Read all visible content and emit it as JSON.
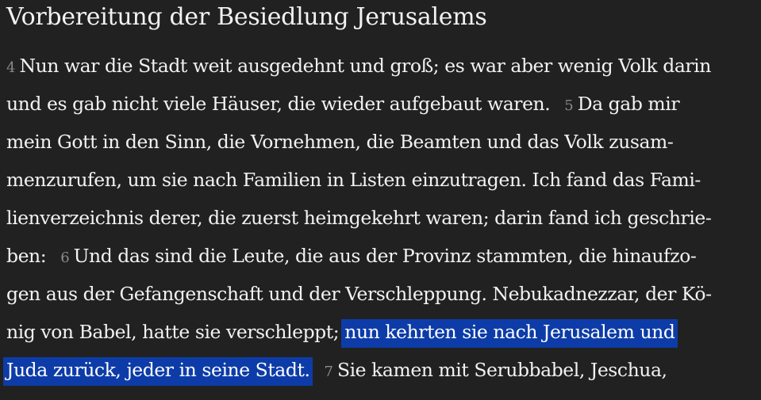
{
  "heading": "Vorbereitung der Besiedlung Jerusalems",
  "verses": {
    "v4": "4",
    "v5": "5",
    "v6": "6",
    "v7": "7"
  },
  "lines": {
    "l1": "Nun war die Stadt weit ausgedehnt und groß; es war aber wenig Volk darin",
    "l2": "und es gab nicht viele Häuser, die wieder aufgebaut waren.",
    "l2b": "Da gab mir",
    "l3": "mein Gott in den Sinn, die Vornehmen, die Beamten und das Volk zusam-",
    "l4": "menzurufen, um sie nach Familien in Listen einzutragen. Ich fand das Fami-",
    "l5": "lienverzeichnis derer, die zuerst heimgekehrt waren; darin fand ich geschrie-",
    "l6a": "ben:",
    "l6b": "Und das sind die Leute, die aus der Provinz stammten, die hinaufzo-",
    "l7": "gen aus der Gefangenschaft und der Verschleppung. Nebukadnezzar, der Kö-",
    "l8a": "nig von Babel, hatte sie verschleppt;",
    "l8hl": "nun kehrten sie nach Jerusalem und",
    "l9hl": "Juda zurück, jeder in seine Stadt.",
    "l9b": "Sie kamen mit Serubbabel, Jeschua,"
  },
  "colors": {
    "background": "#212121",
    "text": "#f2f2f2",
    "verse_number": "#8a8a8a",
    "selection_highlight": "#0d3ca8"
  }
}
